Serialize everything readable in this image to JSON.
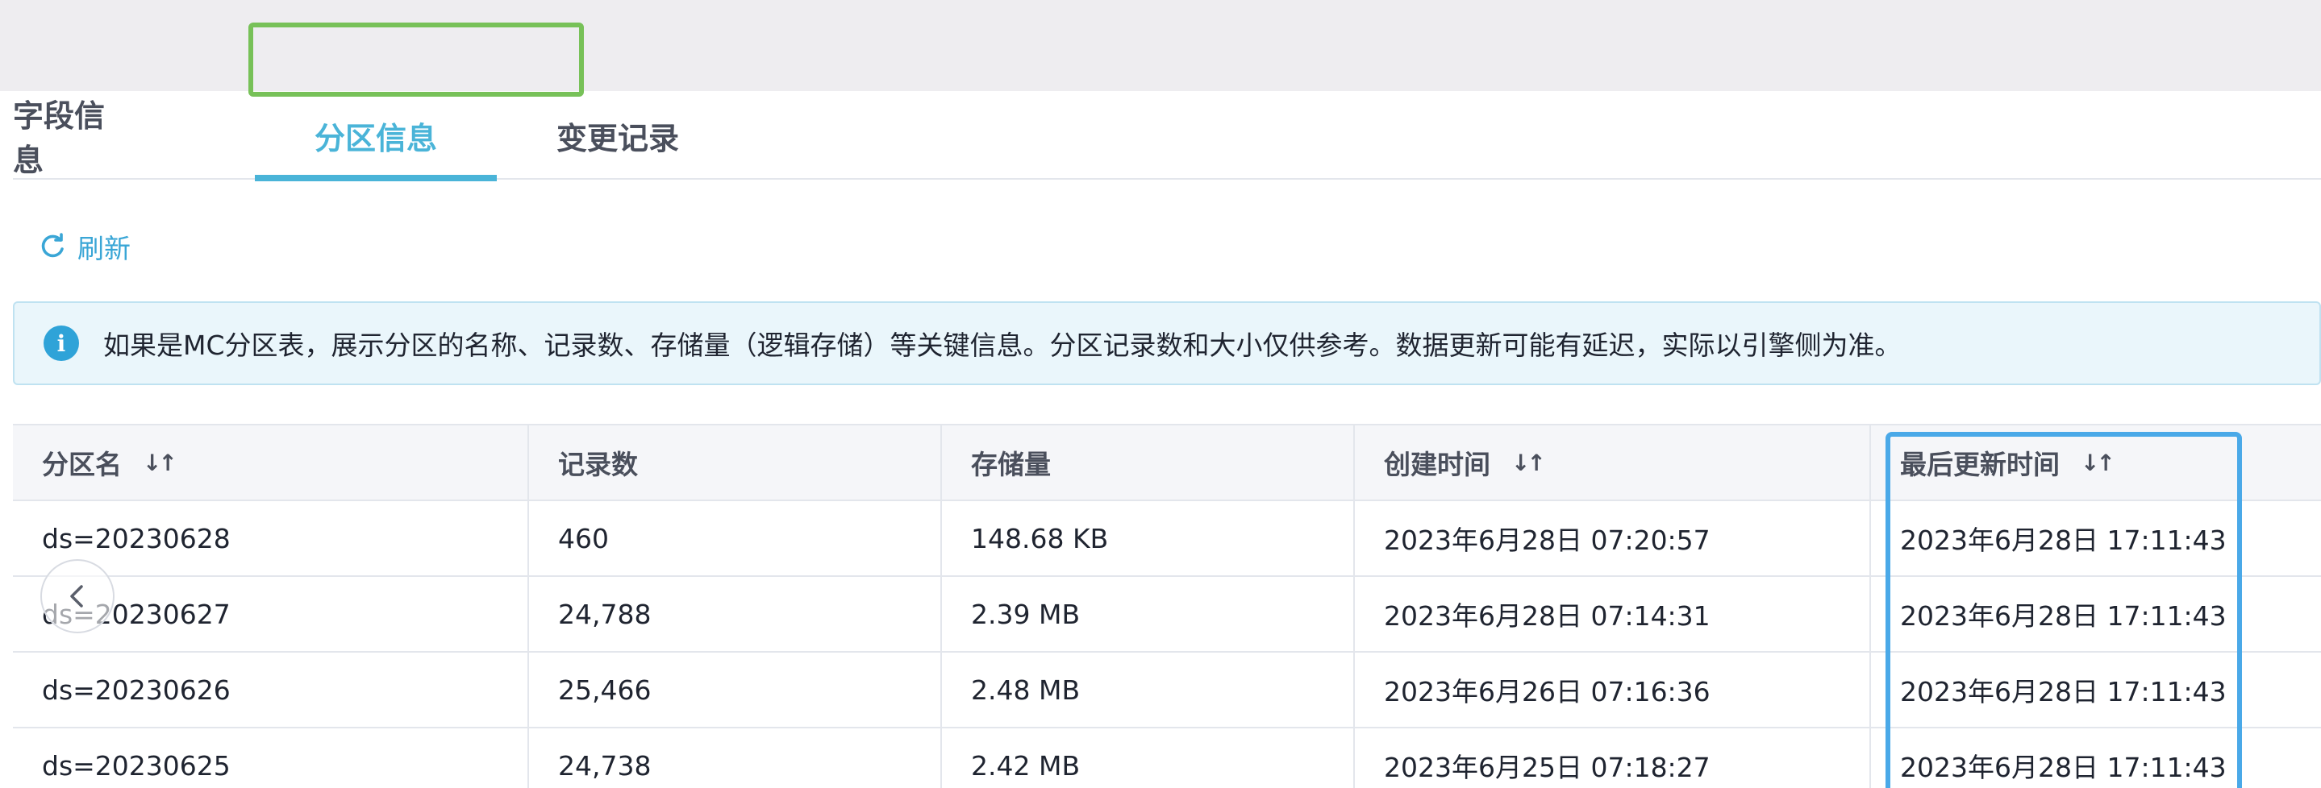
{
  "tabs": [
    {
      "label": "字段信息",
      "active": false
    },
    {
      "label": "分区信息",
      "active": true
    },
    {
      "label": "变更记录",
      "active": false
    }
  ],
  "toolbar": {
    "refresh_label": "刷新",
    "refresh_icon": "refresh-icon"
  },
  "notice": {
    "icon": "info-icon",
    "icon_glyph": "i",
    "text": "如果是MC分区表，展示分区的名称、记录数、存储量（逻辑存储）等关键信息。分区记录数和大小仅供参考。数据更新可能有延迟，实际以引擎侧为准。"
  },
  "table": {
    "columns": [
      "分区名",
      "记录数",
      "存储量",
      "创建时间",
      "最后更新时间"
    ],
    "sortable_columns": [
      "分区名",
      "创建时间",
      "最后更新时间"
    ],
    "sort_glyph": "↓↑",
    "rows": [
      [
        "ds=20230628",
        "460",
        "148.68 KB",
        "2023年6月28日 07:20:57",
        "2023年6月28日 17:11:43"
      ],
      [
        "ds=20230627",
        "24,788",
        "2.39 MB",
        "2023年6月28日 07:14:31",
        "2023年6月28日 17:11:43"
      ],
      [
        "ds=20230626",
        "25,466",
        "2.48 MB",
        "2023年6月26日 07:16:36",
        "2023年6月28日 17:11:43"
      ],
      [
        "ds=20230625",
        "24,738",
        "2.42 MB",
        "2023年6月25日 07:18:27",
        "2023年6月28日 17:11:43"
      ]
    ]
  },
  "colors": {
    "accent": "#4ab4d8",
    "highlight_green": "#77c158",
    "highlight_blue": "#4aa9e8",
    "notice_bg": "#eaf6fb"
  }
}
